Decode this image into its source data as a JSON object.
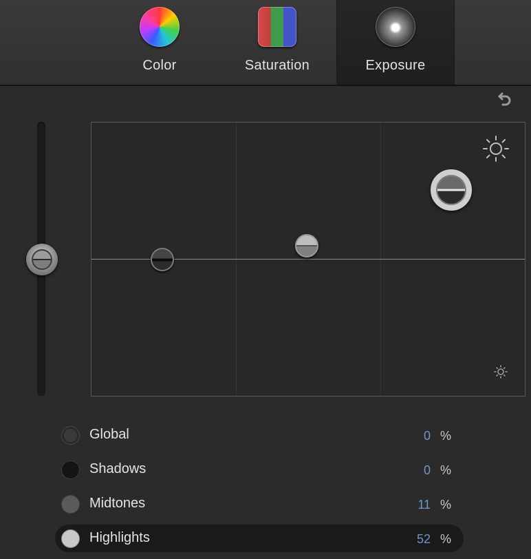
{
  "tabs": [
    {
      "label": "Color",
      "icon": "color-wheel-icon",
      "active": false
    },
    {
      "label": "Saturation",
      "icon": "saturation-bars-icon",
      "active": false
    },
    {
      "label": "Exposure",
      "icon": "exposure-icon",
      "active": true
    }
  ],
  "controls": {
    "reset_icon": "reset-arrow-icon",
    "sun_large_icon": "bright-sun-icon",
    "sun_small_icon": "dim-sun-icon"
  },
  "channels": [
    {
      "name": "Global",
      "value": "0",
      "unit": "%",
      "color": "#3a3a3a"
    },
    {
      "name": "Shadows",
      "value": "0",
      "unit": "%",
      "color": "#141414"
    },
    {
      "name": "Midtones",
      "value": "11",
      "unit": "%",
      "color": "#5a5a5a"
    },
    {
      "name": "Highlights",
      "value": "52",
      "unit": "%",
      "color": "#c8c8c8",
      "selected": true
    }
  ],
  "colors": {
    "value_accent": "#6f96c4",
    "background": "#2b2b2b"
  }
}
